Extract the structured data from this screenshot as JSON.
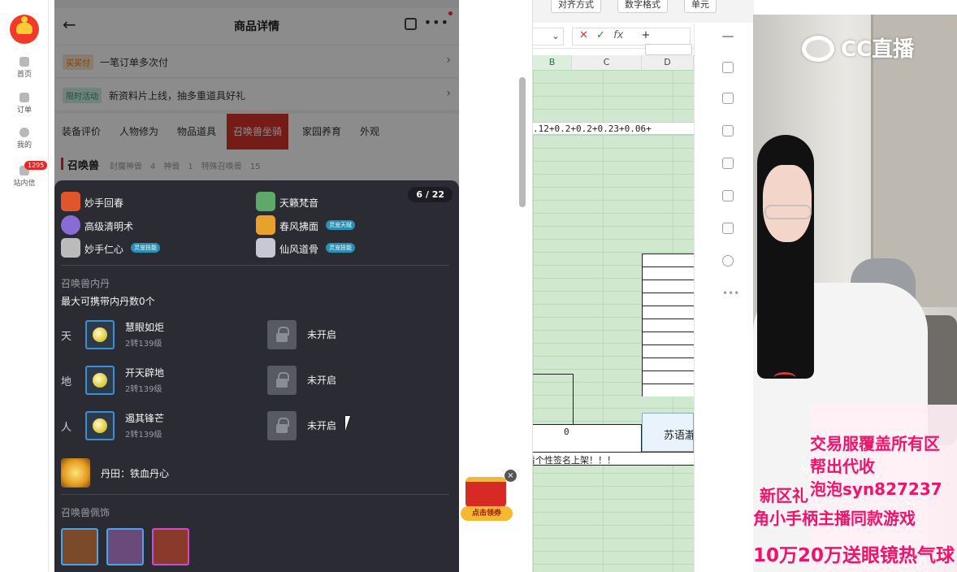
{
  "nav": {
    "home": "首页",
    "orders": "订单",
    "mine": "我的",
    "inbox": "站内信",
    "inbox_badge": "1295"
  },
  "detail": {
    "title": "商品详情",
    "promo1_tag": "买买付",
    "promo1_text": "一笔订单多次付",
    "promo2_tag": "限时活动",
    "promo2_text": "新资料片上线，抽多重道具好礼",
    "tabs": [
      "装备评价",
      "人物修为",
      "物品道具",
      "召唤兽坐骑",
      "家园养育",
      "外观"
    ],
    "section_title": "召唤兽",
    "section_meta": "封魔神兽　4　神兽　1　特殊召唤兽　15"
  },
  "overlay": {
    "counter": "6 / 22",
    "skills": [
      {
        "name": "妙手回春",
        "icon": "heal-skill-icon",
        "color": "#e0562a"
      },
      {
        "name": "天籁梵音",
        "icon": "music-skill-icon",
        "color": "#5fa86a"
      },
      {
        "name": "高级清明术",
        "icon": "clarity-skill-icon",
        "color": "#8a6bd6"
      },
      {
        "name": "春风拂面",
        "icon": "wind-skill-icon",
        "color": "#e8a22c",
        "chip": "灵宠天赋"
      },
      {
        "name": "妙手仁心",
        "icon": "heart-skill-icon",
        "color": "#bbbbbb",
        "chip": "灵宠技能"
      },
      {
        "name": "仙风道骨",
        "icon": "immortal-skill-icon",
        "color": "#c8c8d2",
        "chip": "灵宠技能"
      }
    ],
    "neidan_title": "召唤兽内丹",
    "neidan_max": "最大可携带内丹数0个",
    "neidan": [
      {
        "side": "天",
        "name": "慧眼如炬",
        "level": "2转139级",
        "slot2": "未开启"
      },
      {
        "side": "地",
        "name": "开天辟地",
        "level": "2转139级",
        "slot2": "未开启"
      },
      {
        "side": "人",
        "name": "遏其锋芒",
        "level": "2转139级",
        "slot2": "未开启"
      }
    ],
    "dantian": "丹田：铁血丹心",
    "decor_title": "召唤兽佩饰",
    "decor": [
      {
        "icon": "armor-decor-icon",
        "border": "#4aa3e8"
      },
      {
        "icon": "scroll-decor-icon",
        "border": "#4aa3e8"
      },
      {
        "icon": "necklace-decor-icon",
        "border": "#c94bd1"
      }
    ]
  },
  "redpack": {
    "label": "点击领券",
    "close": "×"
  },
  "sheet": {
    "ribbon": [
      "对齐方式",
      "数字格式",
      "单元"
    ],
    "fx": "fx",
    "plus": "+",
    "cols": [
      "B",
      "C",
      "D"
    ],
    "formula_cell": ".12+0.2+0.2+0.23+0.06+",
    "zero": "0",
    "note": "看个性签名上架！！！",
    "suyu": "苏语瀞"
  },
  "cam": {
    "brand": "CC直播",
    "fen": "分",
    "lines": [
      "交易服覆盖所有区",
      "帮出代收",
      "新区礼",
      "泡泡syn827237",
      "角小手柄主播同款游戏",
      "10万20万送眼镜热气球"
    ]
  }
}
